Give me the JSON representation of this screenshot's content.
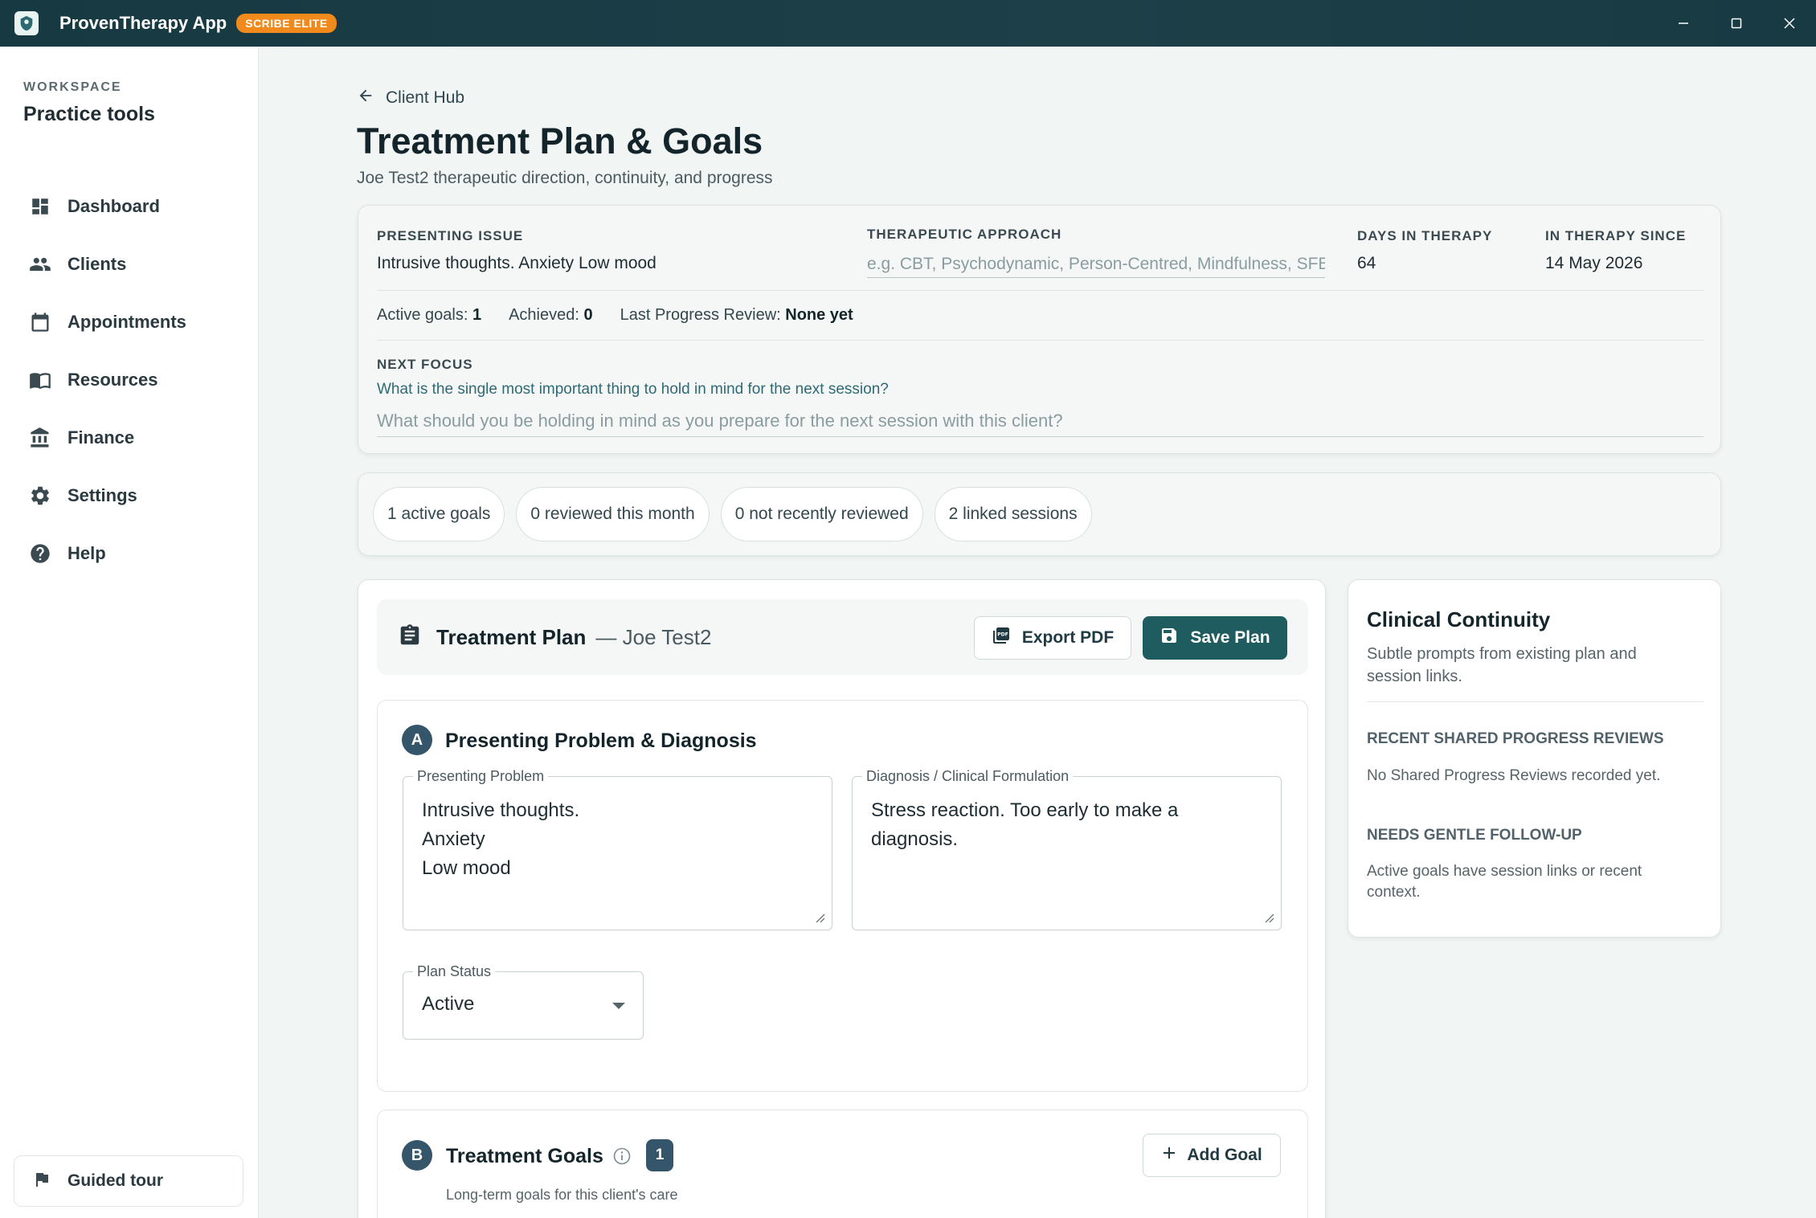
{
  "window": {
    "app_title": "ProvenTherapy App",
    "badge": "SCRIBE ELITE",
    "controls": [
      "minimize-icon",
      "maximize-icon",
      "close-icon"
    ]
  },
  "sidebar": {
    "workspace_label": "WORKSPACE",
    "workspace_name": "Practice tools",
    "items": [
      {
        "label": "Dashboard",
        "icon": "dashboard-icon"
      },
      {
        "label": "Clients",
        "icon": "people-icon"
      },
      {
        "label": "Appointments",
        "icon": "calendar-icon"
      },
      {
        "label": "Resources",
        "icon": "book-icon"
      },
      {
        "label": "Finance",
        "icon": "bank-icon"
      },
      {
        "label": "Settings",
        "icon": "gear-icon"
      },
      {
        "label": "Help",
        "icon": "help-icon"
      }
    ],
    "tour_label": "Guided tour"
  },
  "header": {
    "back_label": "Client Hub",
    "title": "Treatment Plan & Goals",
    "subtitle": "Joe Test2 therapeutic direction, continuity, and progress"
  },
  "summary": {
    "presenting_issue_label": "PRESENTING ISSUE",
    "presenting_issue_value": "Intrusive thoughts. Anxiety Low mood",
    "approach_label": "THERAPEUTIC APPROACH",
    "approach_placeholder": "e.g. CBT, Psychodynamic, Person-Centred, Mindfulness, SFBT",
    "days_label": "DAYS IN THERAPY",
    "days_value": "64",
    "since_label": "IN THERAPY SINCE",
    "since_value": "14 May 2026",
    "active_goals_label": "Active goals:",
    "active_goals_value": "1",
    "achieved_label": "Achieved:",
    "achieved_value": "0",
    "last_review_label": "Last Progress Review:",
    "last_review_value": "None yet",
    "next_focus_label": "NEXT FOCUS",
    "next_focus_question": "What is the single most important thing to hold in mind for the next session?",
    "next_focus_placeholder": "What should you be holding in mind as you prepare for the next session with this client?"
  },
  "chips": [
    "1 active goals",
    "0 reviewed this month",
    "0 not recently reviewed",
    "2 linked sessions"
  ],
  "plan": {
    "title": "Treatment Plan",
    "client": "— Joe Test2",
    "export_label": "Export PDF",
    "save_label": "Save Plan",
    "section_a": {
      "letter": "A",
      "title": "Presenting Problem & Diagnosis",
      "problem_legend": "Presenting Problem",
      "problem_text": "Intrusive thoughts.\nAnxiety\nLow mood",
      "diagnosis_legend": "Diagnosis / Clinical Formulation",
      "diagnosis_text": "Stress reaction. Too early to make a\ndiagnosis.",
      "status_legend": "Plan Status",
      "status_value": "Active"
    },
    "section_b": {
      "letter": "B",
      "title": "Treatment Goals",
      "count": "1",
      "subtitle": "Long-term goals for this client's care",
      "add_label": "Add Goal"
    }
  },
  "continuity": {
    "title": "Clinical Continuity",
    "subtitle": "Subtle prompts from existing plan and session links.",
    "reviews_heading": "RECENT SHARED PROGRESS REVIEWS",
    "reviews_text": "No Shared Progress Reviews recorded yet.",
    "followup_heading": "NEEDS GENTLE FOLLOW-UP",
    "followup_text": "Active goals have session links or recent context."
  },
  "colors": {
    "titlebar": "#173942",
    "accent": "#1f5c5f",
    "badge": "#f08a1c",
    "section_badge": "#35556a"
  }
}
